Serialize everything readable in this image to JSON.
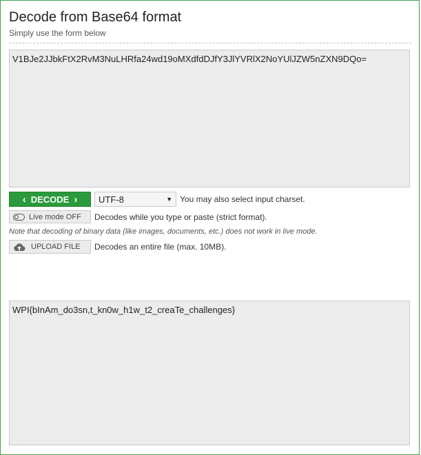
{
  "header": {
    "title": "Decode from Base64 format",
    "subtitle": "Simply use the form below"
  },
  "input": {
    "value": "V1BJe2JJbkFtX2RvM3NuLHRfa24wd19oMXdfdDJfY3JlYVRlX2NoYUlJZW5nZXN9DQo="
  },
  "controls": {
    "decode_label": "DECODE",
    "charset_selected": "UTF-8",
    "charset_hint": "You may also select input charset.",
    "live_mode_label": "Live mode OFF",
    "live_mode_hint": "Decodes while you type or paste (strict format).",
    "binary_note": "Note that decoding of binary data (like images, documents, etc.) does not work in live mode.",
    "upload_label": "UPLOAD FILE",
    "upload_hint": "Decodes an entire file (max. 10MB)."
  },
  "output": {
    "value": "WPI{bInAm_do3sn,t_kn0w_h1w_t2_creaTe_challenges}"
  },
  "colors": {
    "accent_green": "#2b9a3c",
    "frame_green": "#3fa34d",
    "textarea_bg": "#ececec"
  },
  "icons": {
    "decode_left": "chevron-left-icon",
    "decode_right": "chevron-right-icon",
    "select_caret": "caret-down-icon",
    "toggle": "toggle-off-icon",
    "upload": "cloud-upload-icon"
  }
}
